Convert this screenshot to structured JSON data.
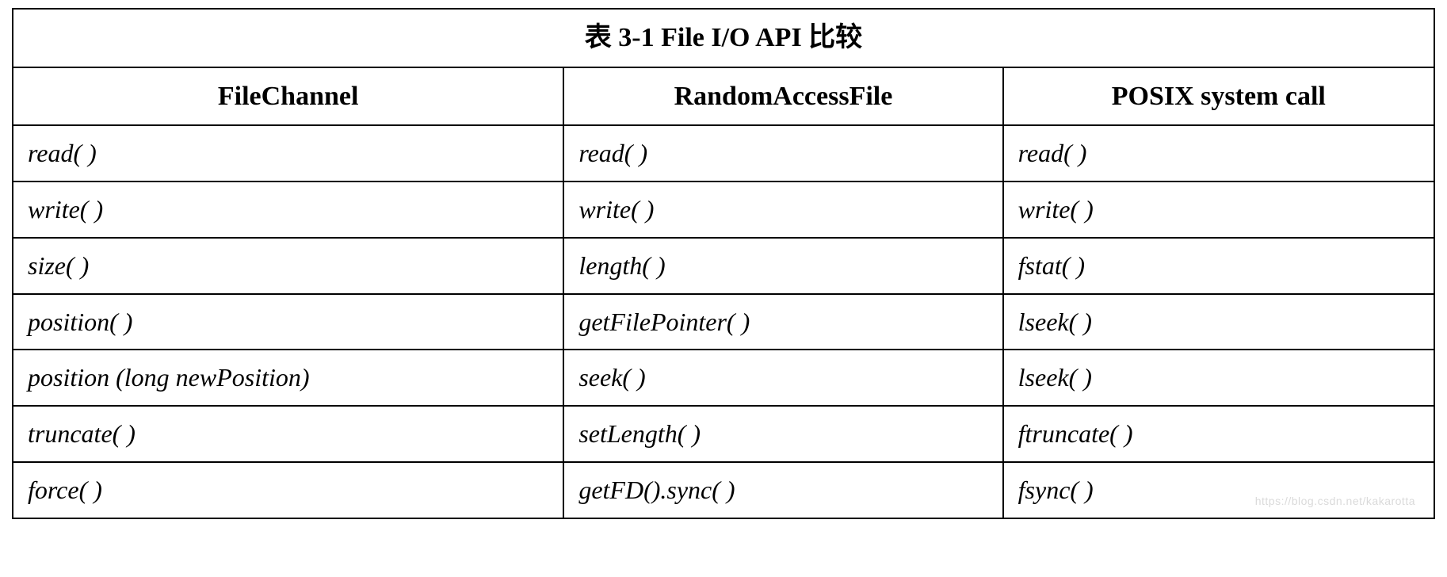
{
  "table": {
    "title": "表 3-1 File I/O API 比较",
    "columns": {
      "col0": "FileChannel",
      "col1": "RandomAccessFile",
      "col2": "POSIX system call"
    },
    "rows": [
      {
        "col0": "read( )",
        "col1": "read( )",
        "col2": "read( )"
      },
      {
        "col0": "write( )",
        "col1": "write( )",
        "col2": "write( )"
      },
      {
        "col0": "size( )",
        "col1": "length( )",
        "col2": "fstat( )"
      },
      {
        "col0": "position( )",
        "col1": "getFilePointer( )",
        "col2": "lseek( )"
      },
      {
        "col0": "position (long newPosition)",
        "col1": "seek( )",
        "col2": "lseek( )"
      },
      {
        "col0": "truncate( )",
        "col1": "setLength( )",
        "col2": "ftruncate( )"
      },
      {
        "col0": "force( )",
        "col1": "getFD().sync( )",
        "col2": "fsync( )"
      }
    ]
  },
  "watermark": "https://blog.csdn.net/kakarotta"
}
